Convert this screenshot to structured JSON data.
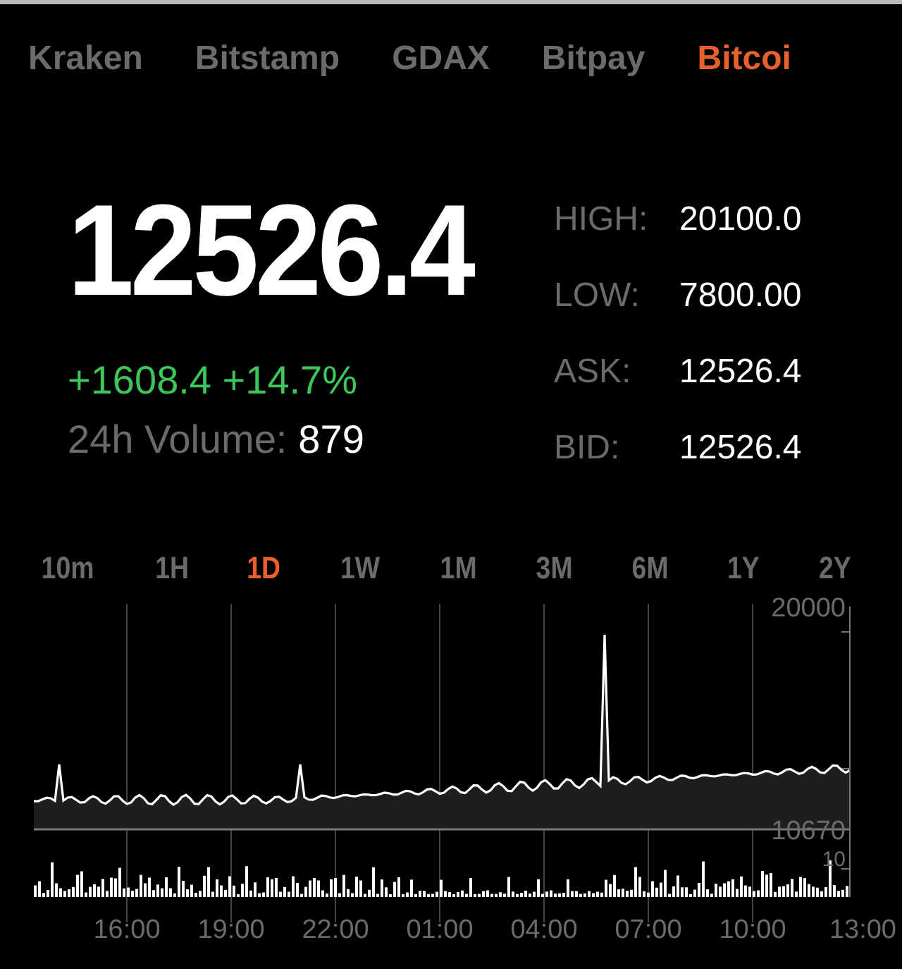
{
  "exchanges": [
    {
      "label": "Kraken",
      "selected": false
    },
    {
      "label": "Bitstamp",
      "selected": false
    },
    {
      "label": "GDAX",
      "selected": false
    },
    {
      "label": "Bitpay",
      "selected": false
    },
    {
      "label": "Bitcoi",
      "selected": true
    }
  ],
  "price": "12526.4",
  "change": "+1608.4 +14.7%",
  "volume": {
    "label": "24h Volume:",
    "value": "879"
  },
  "stats": [
    {
      "label": "HIGH:",
      "value": "20100.0"
    },
    {
      "label": "LOW:",
      "value": "7800.00"
    },
    {
      "label": "ASK:",
      "value": "12526.4"
    },
    {
      "label": "BID:",
      "value": "12526.4"
    }
  ],
  "ranges": [
    {
      "label": "10m",
      "selected": false
    },
    {
      "label": "1H",
      "selected": false
    },
    {
      "label": "1D",
      "selected": true
    },
    {
      "label": "1W",
      "selected": false
    },
    {
      "label": "1M",
      "selected": false
    },
    {
      "label": "3M",
      "selected": false
    },
    {
      "label": "6M",
      "selected": false
    },
    {
      "label": "1Y",
      "selected": false
    },
    {
      "label": "2Y",
      "selected": false
    }
  ],
  "chart": {
    "y_labels": [
      "20000",
      "10670",
      "10"
    ],
    "x_labels": [
      "16:00",
      "19:00",
      "22:00",
      "01:00",
      "04:00",
      "07:00",
      "10:00",
      "13:00"
    ]
  }
}
